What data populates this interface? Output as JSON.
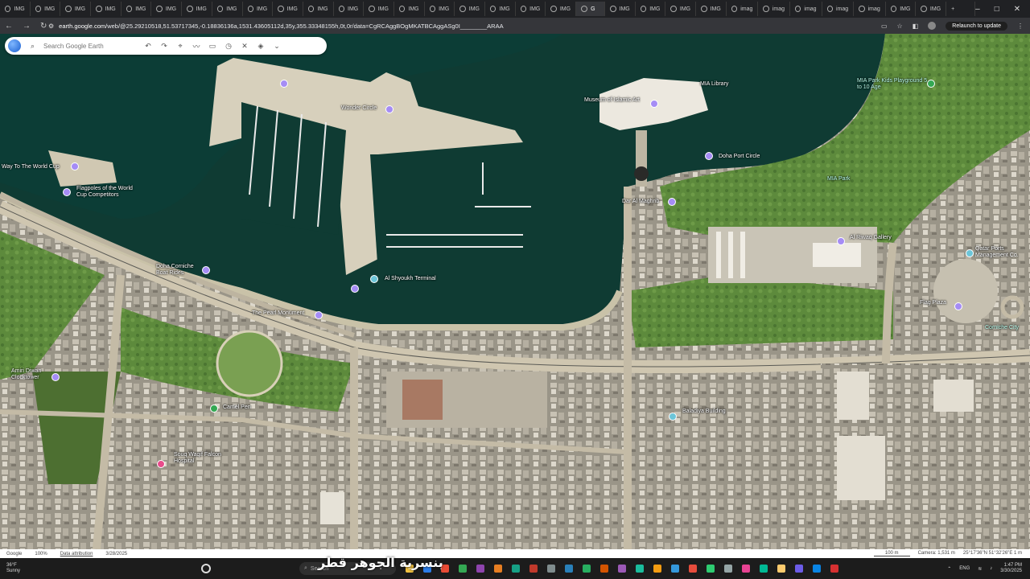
{
  "browser": {
    "tabs": [
      "IMG",
      "IMG",
      "IMG",
      "IMG",
      "IMG",
      "IMG",
      "IMG",
      "IMG",
      "IMG",
      "IMG",
      "IMG",
      "IMG",
      "IMG",
      "IMG",
      "IMG",
      "IMG",
      "IMG",
      "IMG",
      "IMG",
      "G",
      "IMG",
      "IMG",
      "IMG",
      "IMG",
      "imag",
      "imag",
      "imag",
      "imag",
      "imag",
      "IMG",
      "IMG"
    ],
    "active_tab_index": 19,
    "url_host": "earth.google.com",
    "url_rest": "/web/@25.29210518,51.53717345,-0.18836136a,1531.43605112d,35y,355.33348155h,0t,0r/data=CgRCAggBOgMKATBCAggASg0I________ARAA",
    "relaunch_label": "Relaunch to update",
    "window_controls": [
      "–",
      "□",
      "✕"
    ]
  },
  "earth": {
    "search_placeholder": "Search Google Earth",
    "tools": [
      "undo-icon",
      "redo-icon",
      "pin-icon",
      "path-icon",
      "measure-icon",
      "history-icon",
      "project-icon",
      "layers-icon",
      "chevron-down-icon"
    ]
  },
  "places": [
    {
      "id": "wonder-circle",
      "label": "Wonder Circle"
    },
    {
      "id": "museum-islamic-art",
      "label": "Museum of Islamic Art"
    },
    {
      "id": "mia-library",
      "label": "MIA Library"
    },
    {
      "id": "mia-kids",
      "label": "MIA Park Kids Playground 5 to 10 Age"
    },
    {
      "id": "doha-port-circle",
      "label": "Doha Port Circle"
    },
    {
      "id": "mia-park",
      "label": "MIA Park"
    },
    {
      "id": "way-to-world-cup",
      "label": "Way To The World Cup"
    },
    {
      "id": "flagpoles",
      "label": "Flagpoles of the World Cup Competitors"
    },
    {
      "id": "dar-al-maghrib",
      "label": "Dar Al Maghrib"
    },
    {
      "id": "al-riwaq",
      "label": "Al Riwaq Gallery"
    },
    {
      "id": "qatar-ports",
      "label": "Qatar Ports Management Co."
    },
    {
      "id": "corniche-boat",
      "label": "Doha Corniche Boat Rides"
    },
    {
      "id": "al-shyoukh",
      "label": "Al Shyoukh Terminal"
    },
    {
      "id": "pearl-monument",
      "label": "The Pearl Monument"
    },
    {
      "id": "flag-plaza",
      "label": "Flag Plaza"
    },
    {
      "id": "corniche-city",
      "label": "Corniche City"
    },
    {
      "id": "amiri-diwan",
      "label": "Amiri Diwan Clocktower"
    },
    {
      "id": "camel-pen",
      "label": "Camel Pen"
    },
    {
      "id": "baladiya",
      "label": "Baladiya Building"
    },
    {
      "id": "souq-waqif-falcon",
      "label": "Souq Waqif Falcon Hospital"
    }
  ],
  "status": {
    "google": "Google",
    "zoom": "100%",
    "attribution": "Data attribution",
    "date": "3/28/2025",
    "scale": "100 m",
    "camera": "Camera: 1,531 m",
    "coords": "25°17'36\"N 51°32'26\"E 1 m"
  },
  "overlay_text": "بنسرية الجوهر قطر",
  "taskbar": {
    "weather_temp": "36°F",
    "weather_cond": "Sunny",
    "search_label": "Search",
    "lang": "ENG",
    "time": "1:47 PM",
    "date": "3/30/2025",
    "apps": [
      "#f5c542",
      "#2b7de9",
      "#e94b35",
      "#34a853",
      "#8e44ad",
      "#e67e22",
      "#16a085",
      "#c0392b",
      "#7f8c8d",
      "#2980b9",
      "#27ae60",
      "#d35400",
      "#9b59b6",
      "#1abc9c",
      "#f39c12",
      "#3498db",
      "#e74c3c",
      "#2ecc71",
      "#95a5a6",
      "#e84393",
      "#00b894",
      "#fdcb6e",
      "#6c5ce7",
      "#0984e3",
      "#d63031"
    ]
  }
}
